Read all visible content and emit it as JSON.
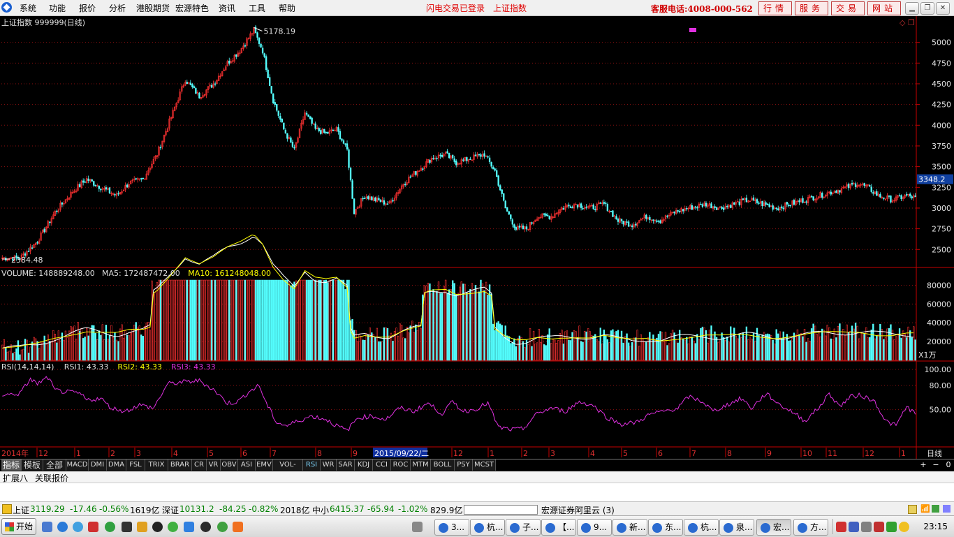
{
  "menu": {
    "items": [
      "系统",
      "功能",
      "报价",
      "分析",
      "港股期货",
      "宏源特色",
      "资讯",
      "工具",
      "帮助"
    ],
    "status_login": "闪电交易已登录",
    "status_index": "上证指数",
    "hotline": "客服电话:4008-000-562",
    "buttons": [
      "行情",
      "服务",
      "交易",
      "网站"
    ]
  },
  "chart_header": {
    "title": "上证指数 999999(日线)"
  },
  "price_panel": {
    "axis_ticks": [
      "5000",
      "4750",
      "4500",
      "4250",
      "4000",
      "3750",
      "3500",
      "3250",
      "3000",
      "2750",
      "2500"
    ],
    "current_price": "3348.2",
    "high_label": "5178.19",
    "low_label": "2384.48"
  },
  "volume_panel": {
    "label": "VOLUME: 148889248.00",
    "ma5": "MA5: 172487472.00",
    "ma10": "MA10: 161248048.00",
    "axis_ticks": [
      "80000",
      "60000",
      "40000",
      "20000"
    ],
    "unit": "X1万"
  },
  "rsi_panel": {
    "label": "RSI(14,14,14)",
    "rsi1": "RSI1: 43.33",
    "rsi2": "RSI2: 43.33",
    "rsi3": "RSI3: 43.33",
    "axis_ticks": [
      "100.00",
      "80.00",
      "50.00"
    ]
  },
  "date_axis": {
    "year": "2014年",
    "months": [
      "12",
      "1",
      "2",
      "3",
      "4",
      "5",
      "6",
      "7",
      "8",
      "9",
      "12",
      "1",
      "2",
      "3",
      "4",
      "5",
      "6",
      "7",
      "8",
      "9",
      "10",
      "11",
      "12",
      "1"
    ],
    "cursor_date": "2015/09/22/二",
    "period": "日线"
  },
  "indicator_tabs": [
    "指标",
    "模板",
    "全部",
    "MACD",
    "DMI",
    "DMA",
    "FSL",
    "TRIX",
    "BRAR",
    "CR",
    "VR",
    "OBV",
    "ASI",
    "EMV",
    "VOL-TDX",
    "RSI",
    "WR",
    "SAR",
    "KDJ",
    "CCI",
    "ROC",
    "MTM",
    "BOLL",
    "PSY",
    "MCST"
  ],
  "right_buttons": [
    "+",
    "−",
    "0"
  ],
  "ext_tabs": [
    "扩展八",
    "关联报价"
  ],
  "status": {
    "sh_label": "上证",
    "sh_price": "3119.29",
    "sh_change": "-17.46",
    "sh_pct": "-0.56%",
    "sh_amount": "1619亿",
    "sz_label": "深证",
    "sz_price": "10131.2",
    "sz_change": "-84.25",
    "sz_pct": "-0.82%",
    "sz_amount": "2018亿",
    "zx_label": "中小",
    "zx_price": "6415.37",
    "zx_change": "-65.94",
    "zx_pct": "-1.02%",
    "zx_amount": "829.9亿",
    "server": "宏源证券阿里云 (3)"
  },
  "taskbar": {
    "start": "开始",
    "tasks": [
      "3...",
      "杭...",
      "子...",
      "【...",
      "9...",
      "新...",
      "东...",
      "杭...",
      "泉...",
      "宏...",
      "方..."
    ],
    "clock": "23:15"
  },
  "colors": {
    "up": "#ff3232",
    "down": "#54ffff",
    "rsi1": "#ffffff",
    "rsi3": "#e030e0",
    "ma5": "#ffffff",
    "ma10": "#ffff00",
    "axis_red": "#c80000"
  },
  "chart_data": {
    "type": "candlestick",
    "title": "上证指数 999999(日线)",
    "period": "daily",
    "y_range": [
      2300,
      5250
    ],
    "y_ticks": [
      2500,
      2750,
      3000,
      3250,
      3500,
      3750,
      4000,
      4250,
      4500,
      4750,
      5000
    ],
    "high": 5178.19,
    "low": 2384.48,
    "last": 3119.29,
    "marked_price": 3348.2,
    "close_path_keypoints": [
      [
        0,
        2400
      ],
      [
        10,
        2395
      ],
      [
        20,
        2600
      ],
      [
        30,
        2950
      ],
      [
        40,
        3200
      ],
      [
        48,
        3350
      ],
      [
        56,
        3250
      ],
      [
        65,
        3150
      ],
      [
        72,
        3300
      ],
      [
        80,
        3350
      ],
      [
        88,
        3650
      ],
      [
        96,
        4100
      ],
      [
        104,
        4550
      ],
      [
        112,
        4350
      ],
      [
        120,
        4500
      ],
      [
        128,
        4750
      ],
      [
        135,
        4900
      ],
      [
        143,
        5150
      ],
      [
        148,
        4900
      ],
      [
        154,
        4300
      ],
      [
        160,
        3950
      ],
      [
        166,
        3700
      ],
      [
        172,
        4150
      ],
      [
        178,
        3950
      ],
      [
        184,
        3900
      ],
      [
        190,
        3950
      ],
      [
        196,
        3700
      ],
      [
        200,
        2950
      ],
      [
        206,
        3150
      ],
      [
        212,
        3100
      ],
      [
        220,
        3050
      ],
      [
        228,
        3300
      ],
      [
        236,
        3450
      ],
      [
        244,
        3600
      ],
      [
        252,
        3650
      ],
      [
        258,
        3550
      ],
      [
        266,
        3600
      ],
      [
        274,
        3650
      ],
      [
        280,
        3450
      ],
      [
        286,
        3000
      ],
      [
        292,
        2750
      ],
      [
        298,
        2750
      ],
      [
        304,
        2900
      ],
      [
        312,
        2900
      ],
      [
        318,
        3000
      ],
      [
        326,
        3050
      ],
      [
        334,
        3000
      ],
      [
        342,
        3050
      ],
      [
        350,
        2850
      ],
      [
        358,
        2800
      ],
      [
        366,
        2900
      ],
      [
        374,
        2850
      ],
      [
        382,
        2950
      ],
      [
        390,
        3000
      ],
      [
        400,
        3050
      ],
      [
        408,
        3000
      ],
      [
        416,
        3050
      ],
      [
        424,
        3100
      ],
      [
        432,
        3050
      ],
      [
        440,
        3000
      ],
      [
        448,
        3050
      ],
      [
        456,
        3100
      ],
      [
        464,
        3150
      ],
      [
        472,
        3200
      ],
      [
        480,
        3250
      ],
      [
        486,
        3300
      ],
      [
        492,
        3250
      ],
      [
        498,
        3150
      ],
      [
        506,
        3100
      ],
      [
        514,
        3150
      ],
      [
        520,
        3119
      ]
    ],
    "volume_y_range": [
      0,
      90000
    ],
    "volume_ticks": [
      20000,
      40000,
      60000,
      80000
    ],
    "volume_unit": "X1万",
    "volume_last": 148889248.0,
    "volume_ma5": 172487472.0,
    "volume_ma10": 161248048.0,
    "rsi_y_range": [
      15,
      100
    ],
    "rsi_ticks": [
      50,
      80,
      100
    ],
    "rsi_last": 43.33,
    "rsi_keypoints": [
      [
        0,
        68
      ],
      [
        10,
        70
      ],
      [
        16,
        88
      ],
      [
        20,
        82
      ],
      [
        26,
        90
      ],
      [
        30,
        74
      ],
      [
        36,
        72
      ],
      [
        44,
        70
      ],
      [
        48,
        62
      ],
      [
        56,
        64
      ],
      [
        62,
        52
      ],
      [
        70,
        48
      ],
      [
        78,
        56
      ],
      [
        86,
        52
      ],
      [
        94,
        82
      ],
      [
        102,
        84
      ],
      [
        112,
        86
      ],
      [
        120,
        75
      ],
      [
        128,
        58
      ],
      [
        134,
        60
      ],
      [
        140,
        72
      ],
      [
        146,
        80
      ],
      [
        150,
        58
      ],
      [
        156,
        34
      ],
      [
        162,
        30
      ],
      [
        168,
        36
      ],
      [
        176,
        42
      ],
      [
        184,
        38
      ],
      [
        190,
        30
      ],
      [
        196,
        24
      ],
      [
        202,
        40
      ],
      [
        210,
        42
      ],
      [
        218,
        38
      ],
      [
        226,
        52
      ],
      [
        234,
        48
      ],
      [
        242,
        58
      ],
      [
        250,
        45
      ],
      [
        256,
        60
      ],
      [
        262,
        48
      ],
      [
        268,
        50
      ],
      [
        276,
        58
      ],
      [
        282,
        28
      ],
      [
        290,
        25
      ],
      [
        296,
        26
      ],
      [
        304,
        45
      ],
      [
        312,
        52
      ],
      [
        320,
        48
      ],
      [
        328,
        60
      ],
      [
        336,
        55
      ],
      [
        344,
        40
      ],
      [
        352,
        32
      ],
      [
        360,
        34
      ],
      [
        368,
        44
      ],
      [
        376,
        48
      ],
      [
        384,
        52
      ],
      [
        390,
        66
      ],
      [
        398,
        60
      ],
      [
        404,
        48
      ],
      [
        412,
        56
      ],
      [
        420,
        64
      ],
      [
        426,
        52
      ],
      [
        434,
        70
      ],
      [
        442,
        56
      ],
      [
        450,
        46
      ],
      [
        456,
        36
      ],
      [
        464,
        52
      ],
      [
        470,
        70
      ],
      [
        476,
        54
      ],
      [
        482,
        66
      ],
      [
        488,
        68
      ],
      [
        496,
        60
      ],
      [
        502,
        36
      ],
      [
        508,
        30
      ],
      [
        514,
        54
      ],
      [
        520,
        43
      ]
    ],
    "date_labels": [
      "2014年",
      "12",
      "1",
      "2",
      "3",
      "4",
      "5",
      "6",
      "7",
      "8",
      "9",
      "2015/09/22/二",
      "12",
      "1",
      "2",
      "3",
      "4",
      "5",
      "6",
      "7",
      "8",
      "9",
      "10",
      "11",
      "12",
      "1"
    ],
    "grid": "dotted-red"
  }
}
